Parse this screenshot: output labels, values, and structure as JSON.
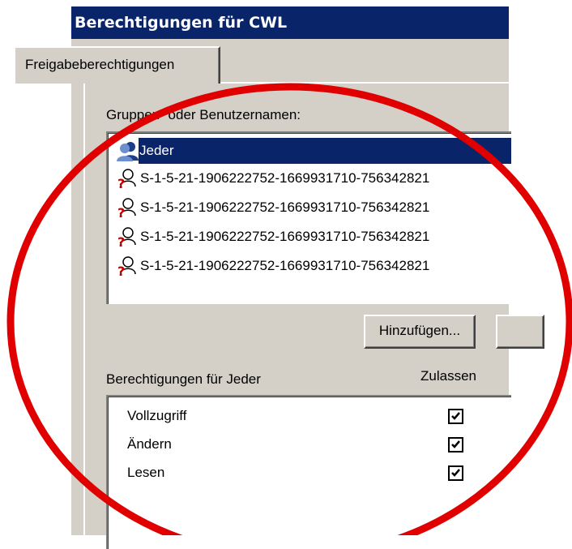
{
  "window": {
    "title": "Berechtigungen für CWL"
  },
  "tabs": [
    {
      "label": "Freigabeberechtigungen"
    }
  ],
  "groups": {
    "label": "Gruppen- oder Benutzernamen:",
    "items": [
      {
        "label": "Jeder",
        "icon": "group-users-icon",
        "selected": true
      },
      {
        "label": "S-1-5-21-1906222752-1669931710-756342821",
        "icon": "unknown-account-icon",
        "selected": false
      },
      {
        "label": "S-1-5-21-1906222752-1669931710-756342821",
        "icon": "unknown-account-icon",
        "selected": false
      },
      {
        "label": "S-1-5-21-1906222752-1669931710-756342821",
        "icon": "unknown-account-icon",
        "selected": false
      },
      {
        "label": "S-1-5-21-1906222752-1669931710-756342821",
        "icon": "unknown-account-icon",
        "selected": false
      }
    ]
  },
  "buttons": {
    "add_label": "Hinzufügen..."
  },
  "permissions": {
    "label": "Berechtigungen für Jeder",
    "allow_column": "Zulassen",
    "rows": [
      {
        "name": "Vollzugriff",
        "allow": true
      },
      {
        "name": "Ändern",
        "allow": true
      },
      {
        "name": "Lesen",
        "allow": true
      }
    ]
  },
  "annotation": {
    "shape": "ellipse",
    "color": "#e00000"
  }
}
